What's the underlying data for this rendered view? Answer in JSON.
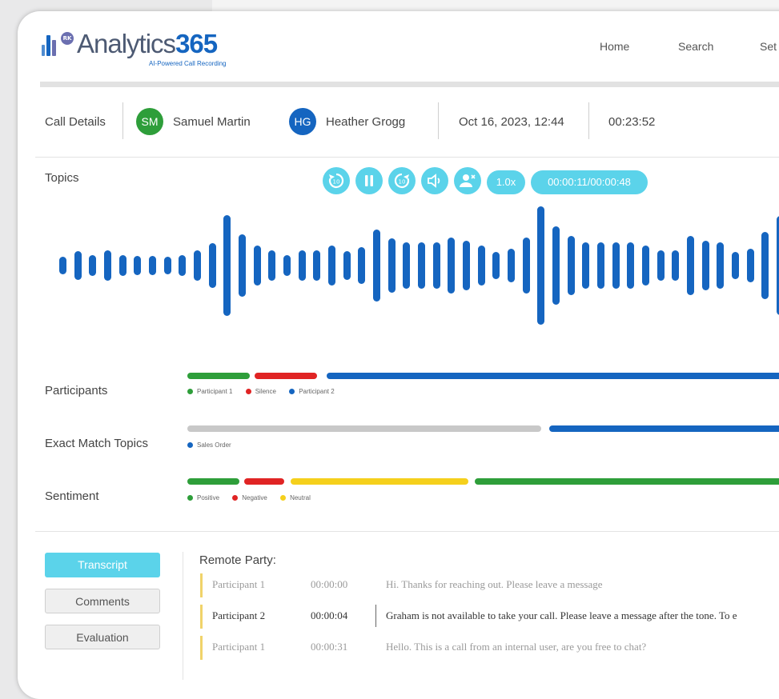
{
  "app": {
    "logo_badge": "RK",
    "logo_name_light": "Analytics",
    "logo_name_bold": "365",
    "tagline": "AI-Powered Call Recording"
  },
  "nav": {
    "home": "Home",
    "search": "Search",
    "settings_partial": "Set"
  },
  "call": {
    "section_label": "Call Details",
    "participant_a": {
      "initials": "SM",
      "name": "Samuel Martin",
      "color": "#2e9e3a"
    },
    "participant_b": {
      "initials": "HG",
      "name": "Heather Grogg",
      "color": "#1565c0"
    },
    "datetime": "Oct 16, 2023, 12:44",
    "duration": "00:23:52"
  },
  "player": {
    "topics_label": "Topics",
    "rewind_icon": "rewind-10-icon",
    "pause_icon": "pause-icon",
    "forward_icon": "forward-10-icon",
    "volume_icon": "volume-icon",
    "speaker_icon": "user-remove-icon",
    "speed": "1.0x",
    "position": "00:00:11/00:00:48",
    "accent_color": "#5bd3ea",
    "wave_color": "#1565c0"
  },
  "tracks": {
    "participants": {
      "label": "Participants",
      "legend": [
        {
          "label": "Participant 1",
          "color": "#2e9e3a"
        },
        {
          "label": "Silence",
          "color": "#e02424"
        },
        {
          "label": "Participant 2",
          "color": "#1565c0"
        }
      ]
    },
    "exact_match": {
      "label": "Exact Match Topics",
      "legend": [
        {
          "label": "Sales Order",
          "color": "#1565c0"
        }
      ]
    },
    "sentiment": {
      "label": "Sentiment",
      "legend": [
        {
          "label": "Positive",
          "color": "#2e9e3a"
        },
        {
          "label": "Negative",
          "color": "#e02424"
        },
        {
          "label": "Neutral",
          "color": "#f5d01c"
        }
      ]
    }
  },
  "tabs": {
    "transcript": "Transcript",
    "comments": "Comments",
    "evaluation": "Evaluation"
  },
  "transcript": {
    "heading": "Remote Party:",
    "rows": [
      {
        "participant": "Participant 1",
        "time": "00:00:00",
        "text": "Hi. Thanks for reaching out. Please leave a message"
      },
      {
        "participant": "Participant 2",
        "time": "00:00:04",
        "text": "Graham is not available to take your call. Please leave a message after the tone. To e"
      },
      {
        "participant": "Participant 1",
        "time": "00:00:31",
        "text": "Hello. This is a call from an internal user, are you free to chat?"
      }
    ]
  }
}
